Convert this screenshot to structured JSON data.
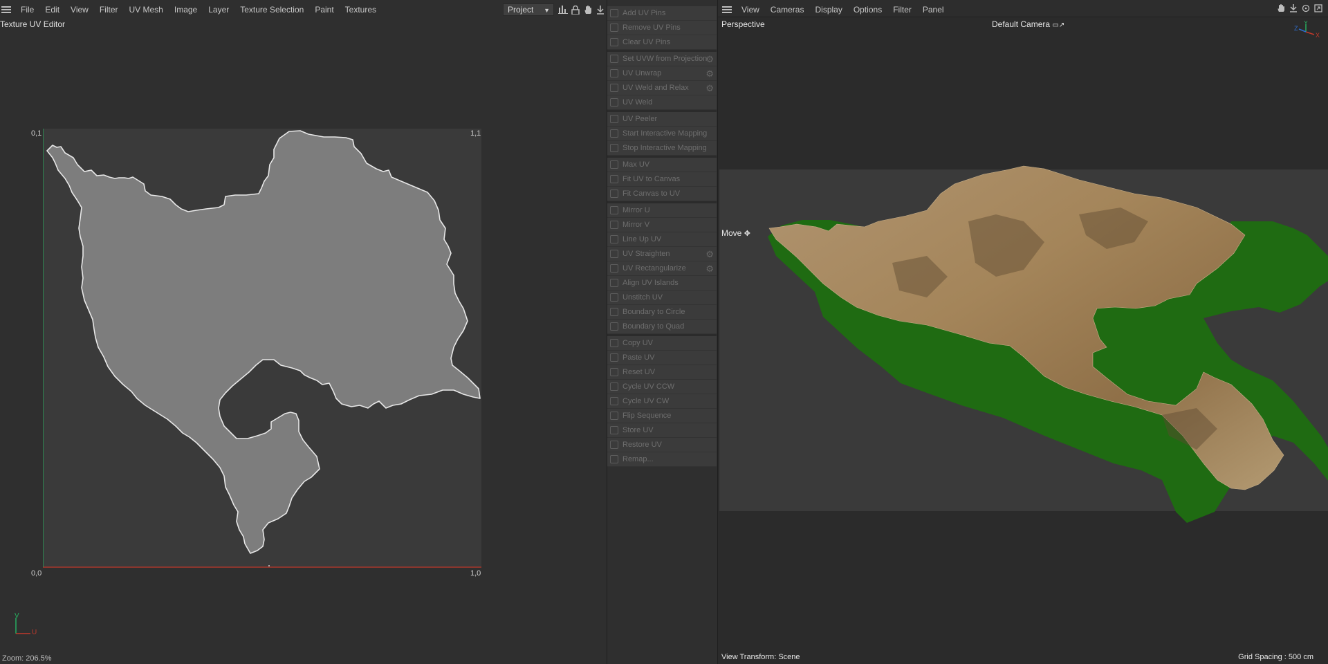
{
  "left_panel": {
    "menu": [
      "File",
      "Edit",
      "View",
      "Filter",
      "UV Mesh",
      "Image",
      "Layer",
      "Texture Selection",
      "Paint",
      "Textures"
    ],
    "title": "Texture UV Editor",
    "project_dropdown": "Project",
    "corners": {
      "top_left": "0,1",
      "top_right": "1,1",
      "bottom_left": "0,0",
      "bottom_right": "1,0"
    },
    "zoom": "Zoom: 206.5%",
    "gizmo": {
      "v": "V",
      "u": "U"
    },
    "icons": [
      "histogram-icon",
      "lock-icon",
      "hand-icon",
      "pan-icon"
    ]
  },
  "uv_commands": {
    "groups": [
      [
        {
          "label": "Add UV Pins",
          "icon": "pin-icon"
        },
        {
          "label": "Remove UV Pins",
          "icon": "unpin-icon"
        },
        {
          "label": "Clear UV Pins",
          "icon": "x-icon"
        }
      ],
      [
        {
          "label": "Set UVW from Projection",
          "icon": "projection-icon",
          "gear": true
        },
        {
          "label": "UV Unwrap",
          "icon": "unwrap-icon",
          "gear": true
        },
        {
          "label": "UV Weld and Relax",
          "icon": "relax-icon",
          "gear": true
        },
        {
          "label": "UV Weld",
          "icon": "weld-icon"
        }
      ],
      [
        {
          "label": "UV Peeler",
          "icon": "peeler-icon"
        },
        {
          "label": "Start Interactive Mapping",
          "icon": "play-icon"
        },
        {
          "label": "Stop Interactive Mapping",
          "icon": "stop-icon"
        }
      ],
      [
        {
          "label": "Max UV",
          "icon": "max-icon"
        },
        {
          "label": "Fit UV to Canvas",
          "icon": "fit-icon"
        },
        {
          "label": "Fit Canvas to UV",
          "icon": "fit-canvas-icon"
        }
      ],
      [
        {
          "label": "Mirror U",
          "icon": "mirror-u-icon"
        },
        {
          "label": "Mirror V",
          "icon": "mirror-v-icon"
        },
        {
          "label": "Line Up UV",
          "icon": "lineup-icon"
        },
        {
          "label": "UV Straighten",
          "icon": "straighten-icon",
          "gear": true
        },
        {
          "label": "UV Rectangularize",
          "icon": "rectangularize-icon",
          "gear": true
        },
        {
          "label": "Align UV Islands",
          "icon": "align-icon"
        },
        {
          "label": "Unstitch UV",
          "icon": "unstitch-icon"
        },
        {
          "label": "Boundary to Circle",
          "icon": "circle-icon"
        },
        {
          "label": "Boundary to Quad",
          "icon": "quad-icon"
        }
      ],
      [
        {
          "label": "Copy UV",
          "icon": "copy-icon"
        },
        {
          "label": "Paste UV",
          "icon": "paste-icon"
        },
        {
          "label": "Reset UV",
          "icon": "reset-icon"
        },
        {
          "label": "Cycle UV CCW",
          "icon": "ccw-icon"
        },
        {
          "label": "Cycle UV CW",
          "icon": "cw-icon"
        },
        {
          "label": "Flip Sequence",
          "icon": "flip-icon"
        },
        {
          "label": "Store UV",
          "icon": "store-icon"
        },
        {
          "label": "Restore UV",
          "icon": "restore-icon"
        },
        {
          "label": "Remap...",
          "icon": "remap-icon"
        }
      ]
    ]
  },
  "right_panel": {
    "menu": [
      "View",
      "Cameras",
      "Display",
      "Options",
      "Filter",
      "Panel"
    ],
    "view_name": "Perspective",
    "camera": "Default Camera",
    "tool": "Move",
    "view_transform": "View Transform: Scene",
    "grid_spacing": "Grid Spacing : 500 cm",
    "axes": {
      "y": "Y",
      "z": "Z",
      "x": "X"
    },
    "icons": [
      "hand-icon",
      "pan-icon",
      "rotate-icon",
      "maximize-icon"
    ]
  },
  "colors": {
    "bg": "#2f2f2f",
    "uv_canvas": "#3a3a3a",
    "island_fill": "#7d7d7d",
    "island_stroke": "#e8e8e8",
    "u_axis": "#c0392b",
    "v_axis": "#27ae60",
    "terrain_side": "#1f6b12",
    "terrain_top": "#a88a5e"
  }
}
